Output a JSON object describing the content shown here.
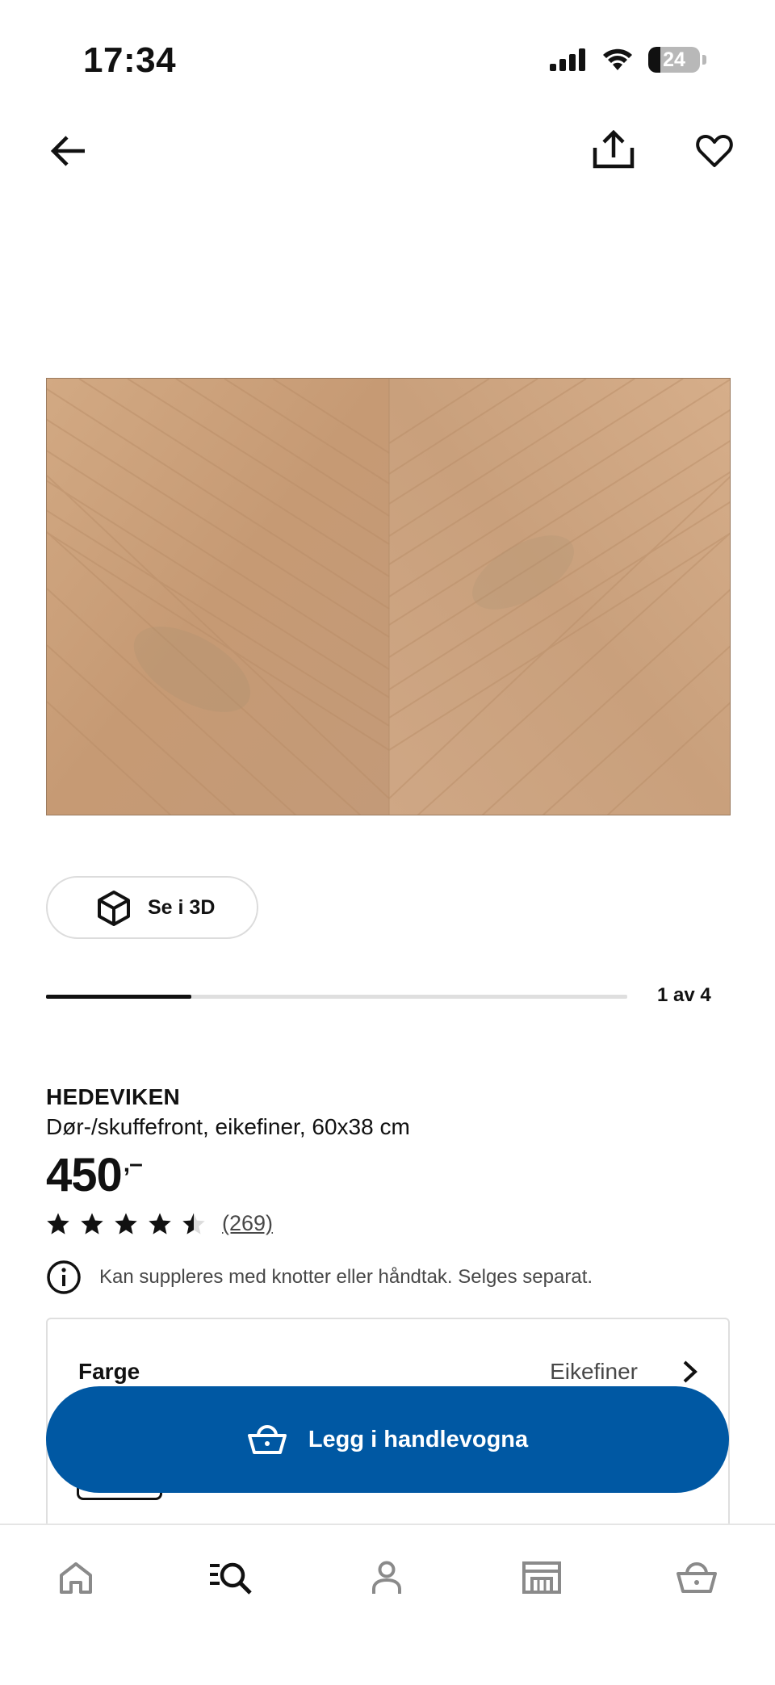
{
  "status_bar": {
    "time": "17:34",
    "battery_level": "24",
    "icons": [
      "signal-icon",
      "wifi-icon",
      "battery-icon"
    ]
  },
  "top_nav": {
    "icons": [
      "back-arrow-icon",
      "share-icon",
      "heart-icon"
    ]
  },
  "gallery": {
    "view_3d_label": "Se i 3D",
    "position_label": "1 av 4",
    "progress_fraction": 0.25
  },
  "product": {
    "name": "HEDEVIKEN",
    "description": "Dør-/skuffefront, eikefiner, 60x38 cm",
    "price": "450",
    "price_suffix": ",–",
    "rating": 4.5,
    "rating_max": 5,
    "review_count": "(269)",
    "info_text": "Kan suppleres med knotter eller håndtak. Selges separat."
  },
  "options": {
    "color_label": "Farge",
    "color_value": "Eikefiner"
  },
  "cart_button": {
    "label": "Legg i handlevogna"
  },
  "bottom_nav": {
    "tabs": [
      "home-icon",
      "search-icon",
      "profile-icon",
      "store-icon",
      "cart-icon"
    ],
    "active": "search-icon"
  },
  "colors": {
    "brand_blue": "#0058a3",
    "text_primary": "#111111",
    "text_secondary": "#484848",
    "wood": "#c99f7c"
  }
}
